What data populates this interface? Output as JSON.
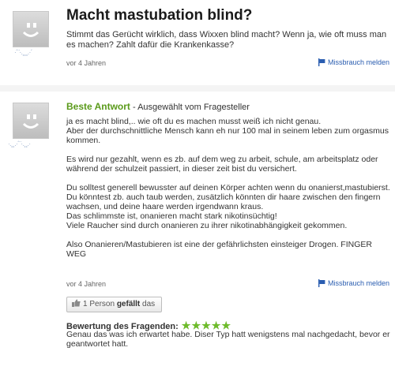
{
  "question": {
    "title": "Macht mastubation blind?",
    "text": "Stimmt das Gerücht wirklich, dass Wixxen blind macht? Wenn ja, wie oft muss man es machen? Zahlt dafür die Krankenkasse?",
    "time": "vor 4 Jahren",
    "report_label": "Missbrauch melden",
    "username": "·´¨·.¸¸¸.·´"
  },
  "answer": {
    "best_label": "Beste Antwort",
    "selected_by": " - Ausgewählt vom Fragesteller",
    "username": "·.¸¸.·´¨·.¸¸.·",
    "paragraphs": [
      "ja es macht blind,.. wie oft du es machen musst weiß ich nicht genau.\nAber der durchschnittliche Mensch kann eh nur 100 mal in seinem leben zum orgasmus kommen.",
      "Es wird nur gezahlt, wenn es zb. auf dem weg zu arbeit, schule, am arbeitsplatz oder während der schulzeit passiert, in dieser zeit bist du versichert.",
      "Du solltest generell bewusster auf deinen Körper achten wenn du onanierst,mastubierst. Du könntest zb. auch taub werden, zusätzlich könnten dir haare zwischen den fingern wachsen, und deine haare werden irgendwann kraus.\nDas schlimmste ist, onanieren macht stark nikotinsüchtig!\nViele Raucher sind durch onanieren zu ihrer nikotinabhängigkeit gekommen.",
      "Also Onanieren/Mastubieren ist eine der gefährlichsten einsteiger Drogen. FINGER WEG"
    ],
    "time": "vor 4 Jahren",
    "report_label": "Missbrauch melden",
    "like": {
      "prefix": "1 Person ",
      "bold": "gefällt",
      "suffix": " das"
    },
    "rating": {
      "label": "Bewertung des Fragenden:",
      "stars": "★★★★★",
      "text": "Genau das was ich erwartet habe. Diser Typ hatt wenigstens mal nachgedacht, bevor er geantwortet hatt."
    }
  },
  "colors": {
    "best_answer": "#5a9a1a",
    "link": "#2a5db0",
    "stars": "#6dbb2a"
  }
}
